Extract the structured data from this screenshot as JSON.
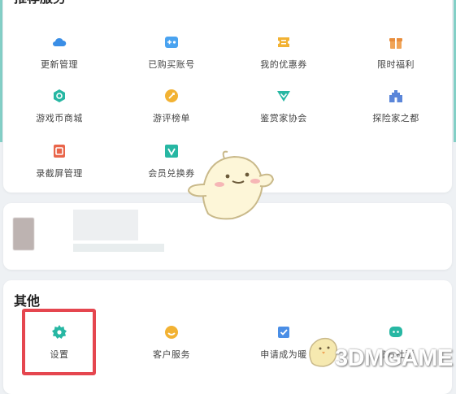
{
  "recommend": {
    "title": "推荐服务",
    "items": [
      {
        "label": "更新管理",
        "icon": "cloud-icon",
        "color": "#3a8ee6"
      },
      {
        "label": "已购买账号",
        "icon": "gamepad-icon",
        "color": "#4aa3f0"
      },
      {
        "label": "我的优惠券",
        "icon": "coupon-icon",
        "color": "#f2b233"
      },
      {
        "label": "限时福利",
        "icon": "gift-icon",
        "color": "#f0a457"
      },
      {
        "label": "游戏币商城",
        "icon": "coin-shop-icon",
        "color": "#27b7a3"
      },
      {
        "label": "游评榜单",
        "icon": "ranking-icon",
        "color": "#f2b233"
      },
      {
        "label": "鉴赏家协会",
        "icon": "connoisseur-icon",
        "color": "#27b7a3"
      },
      {
        "label": "探险家之都",
        "icon": "castle-icon",
        "color": "#5b86d9"
      },
      {
        "label": "录截屏管理",
        "icon": "record-icon",
        "color": "#e9654a"
      },
      {
        "label": "会员兑换券",
        "icon": "vip-coupon-icon",
        "color": "#27b7a3"
      }
    ]
  },
  "other": {
    "title": "其他",
    "items": [
      {
        "label": "设置",
        "icon": "gear-icon",
        "color": "#27b7a3"
      },
      {
        "label": "客户服务",
        "icon": "customer-service-icon",
        "color": "#f2b233"
      },
      {
        "label": "申请成为暖",
        "icon": "apply-icon",
        "color": "#4a8ee6"
      },
      {
        "label": "官方社群",
        "icon": "community-icon",
        "color": "#27b7a3"
      }
    ]
  },
  "watermark": "3DMGAME",
  "highlight_color": "#e5464f"
}
